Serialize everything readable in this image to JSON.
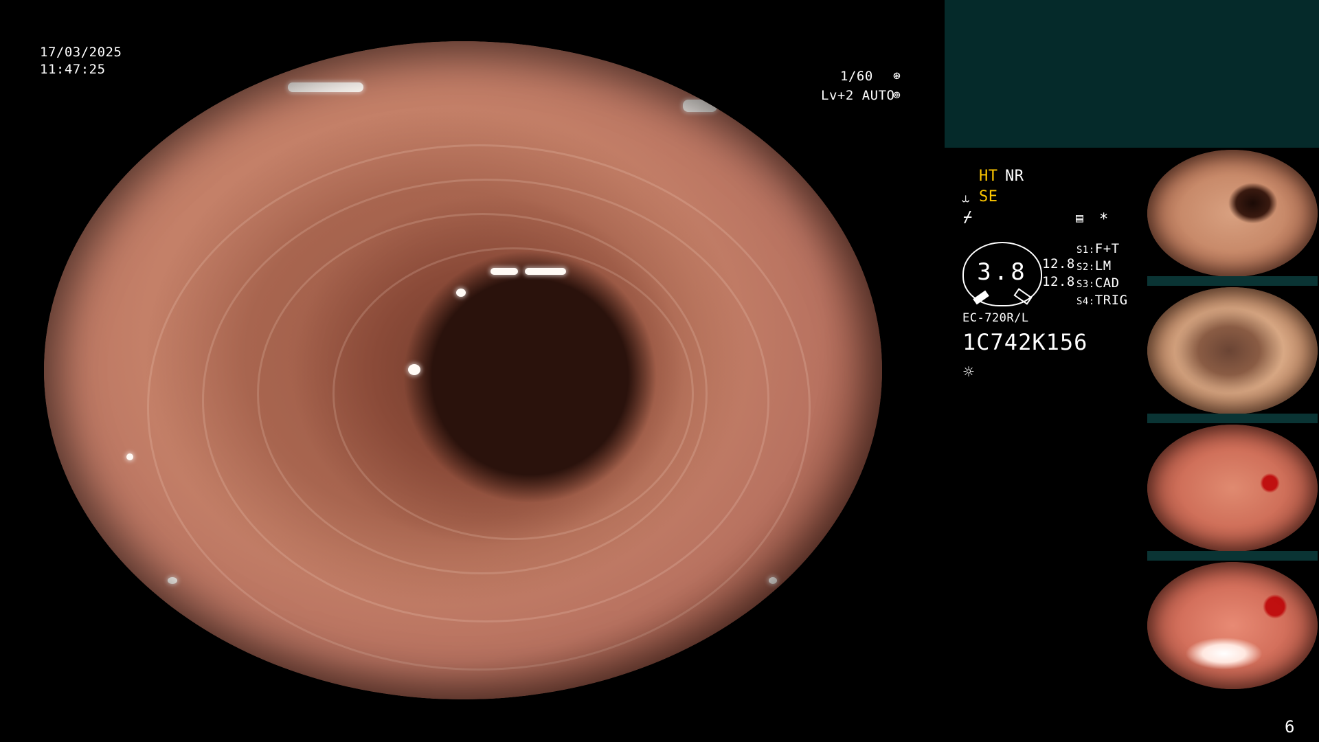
{
  "overlay": {
    "date": "17/03/2025",
    "time": "11:47:25",
    "shutter": "1/60",
    "shutter_icon": "aperture-icon",
    "level": "Lv+2 AUTO",
    "level_icon": "auto-iris-icon"
  },
  "status": {
    "ht": "HT",
    "nr": "NR",
    "se": "SE",
    "se_icon": "scope-tip-icon",
    "freeze_icon": "freeze-icon",
    "memory_icon": "memory-card-icon",
    "asterisk": "*"
  },
  "dial": {
    "value": "3.8",
    "right_values": [
      "12.8",
      "12.8"
    ]
  },
  "switches": [
    {
      "label": "S1:",
      "value": "F+T"
    },
    {
      "label": "S2:",
      "value": "LM"
    },
    {
      "label": "S3:",
      "value": "CAD"
    },
    {
      "label": "S4:",
      "value": "TRIG"
    }
  ],
  "scope": {
    "model": "EC-720R/L",
    "serial": "1C742K156",
    "light_icon": "light-bulb-icon"
  },
  "page_number": "6",
  "colors": {
    "status_accent": "#ffc800",
    "panel_dark": "#052a2a",
    "mucosa": "#c48068"
  }
}
